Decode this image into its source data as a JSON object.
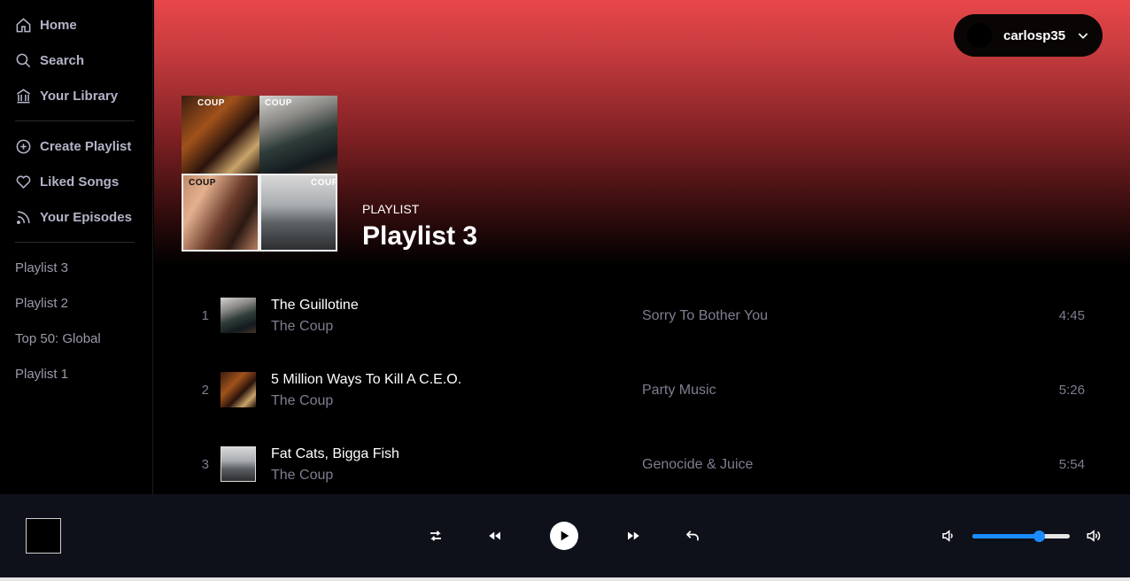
{
  "sidebar": {
    "nav": [
      {
        "label": "Home",
        "icon": "home-icon"
      },
      {
        "label": "Search",
        "icon": "search-icon"
      },
      {
        "label": "Your Library",
        "icon": "library-icon"
      }
    ],
    "actions": [
      {
        "label": "Create Playlist",
        "icon": "plus-circle-icon"
      },
      {
        "label": "Liked Songs",
        "icon": "heart-icon"
      },
      {
        "label": "Your Episodes",
        "icon": "rss-icon"
      }
    ],
    "playlists": [
      "Playlist 3",
      "Playlist 2",
      "Top 50: Global",
      "Playlist 1"
    ]
  },
  "header": {
    "username": "carlosp35"
  },
  "playlist": {
    "type_label": "PLAYLIST",
    "title": "Playlist 3",
    "cover_labels": [
      "COUP",
      "COUP",
      "COUP",
      "COUP"
    ],
    "tracks": [
      {
        "number": "1",
        "name": "The Guillotine",
        "artist": "The Coup",
        "album": "Sorry To Bother You",
        "duration": "4:45"
      },
      {
        "number": "2",
        "name": "5 Million Ways To Kill A C.E.O.",
        "artist": "The Coup",
        "album": "Party Music",
        "duration": "5:26"
      },
      {
        "number": "3",
        "name": "Fat Cats, Bigga Fish",
        "artist": "The Coup",
        "album": "Genocide & Juice",
        "duration": "5:54"
      }
    ]
  },
  "player": {
    "volume_percent": 68,
    "colors": {
      "accent": "#1a8cff",
      "background": "#0e111a"
    }
  },
  "theme": {
    "gradient_top": "#e8474a"
  }
}
